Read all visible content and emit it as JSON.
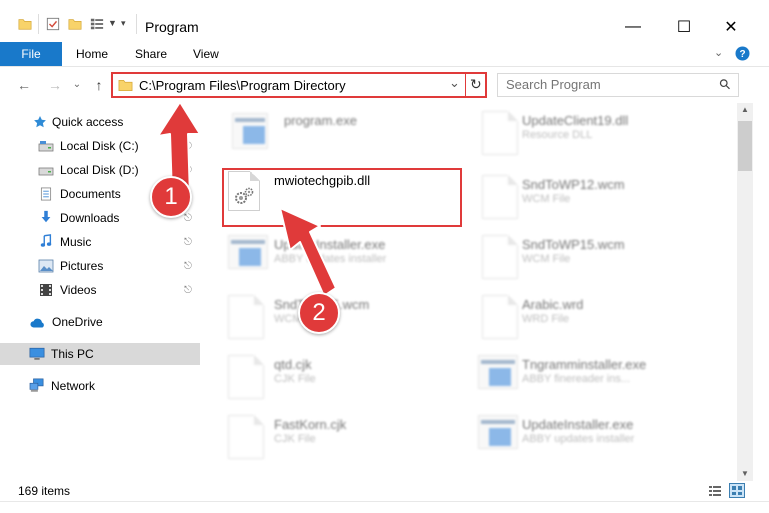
{
  "window": {
    "title": "Program",
    "minimize_glyph": "—",
    "maximize_glyph": "☐",
    "close_glyph": "✕"
  },
  "ribbon": {
    "tabs": [
      "File",
      "Home",
      "Share",
      "View"
    ]
  },
  "address": {
    "path": "C:\\Program Files\\Program Directory",
    "dropdown_glyph": "⌄",
    "refresh_glyph": "↻"
  },
  "search": {
    "placeholder": "Search Program",
    "icon_glyph": "⚲"
  },
  "nav": {
    "back_glyph": "←",
    "forward_glyph": "→",
    "recent_glyph": "⌄",
    "up_glyph": "↑"
  },
  "sidebar": {
    "items": [
      {
        "label": "Quick access",
        "icon": "star-icon"
      },
      {
        "label": "Local Disk (C:)",
        "icon": "drive-icon",
        "pinned": true
      },
      {
        "label": "Local Disk (D:)",
        "icon": "drive-icon",
        "pinned": true
      },
      {
        "label": "Documents",
        "icon": "documents-icon",
        "pinned": true
      },
      {
        "label": "Downloads",
        "icon": "download-icon",
        "pinned": true
      },
      {
        "label": "Music",
        "icon": "music-icon",
        "pinned": true
      },
      {
        "label": "Pictures",
        "icon": "pictures-icon",
        "pinned": true
      },
      {
        "label": "Videos",
        "icon": "videos-icon",
        "pinned": true
      },
      {
        "label": "OneDrive",
        "icon": "cloud-icon"
      },
      {
        "label": "This PC",
        "icon": "monitor-icon",
        "selected": true
      },
      {
        "label": "Network",
        "icon": "network-icon"
      }
    ],
    "pin_glyph": "📌"
  },
  "files": [
    {
      "name": "program.exe",
      "type": ""
    },
    {
      "name": "UpdateClient19.dll",
      "type": "Resource DLL"
    },
    {
      "name": "mwiotechgpib.dll",
      "type": ""
    },
    {
      "name": "SndToWP12.wcm",
      "type": "WCM File"
    },
    {
      "name": "UpdateInstaller.exe",
      "type": "ABBY updates installer"
    },
    {
      "name": "SndToWP15.wcm",
      "type": "WCM File"
    },
    {
      "name": "SndToWP5.wcm",
      "type": "WCM File"
    },
    {
      "name": "Arabic.wrd",
      "type": "WRD File"
    },
    {
      "name": "qtd.cjk",
      "type": "CJK File"
    },
    {
      "name": "Tngramminstaller.exe",
      "type": "ABBY finereader ins..."
    },
    {
      "name": "FastKorn.cjk",
      "type": "CJK File"
    },
    {
      "name": "UpdateInstaller.exe",
      "type": "ABBY updates installer"
    }
  ],
  "status": {
    "item_count": "169 items"
  },
  "annotations": {
    "step1": "1",
    "step2": "2",
    "accent_color": "#e03a3a"
  },
  "colors": {
    "file_tab": "#1979ca",
    "selected_nav": "#d9d9d9"
  }
}
